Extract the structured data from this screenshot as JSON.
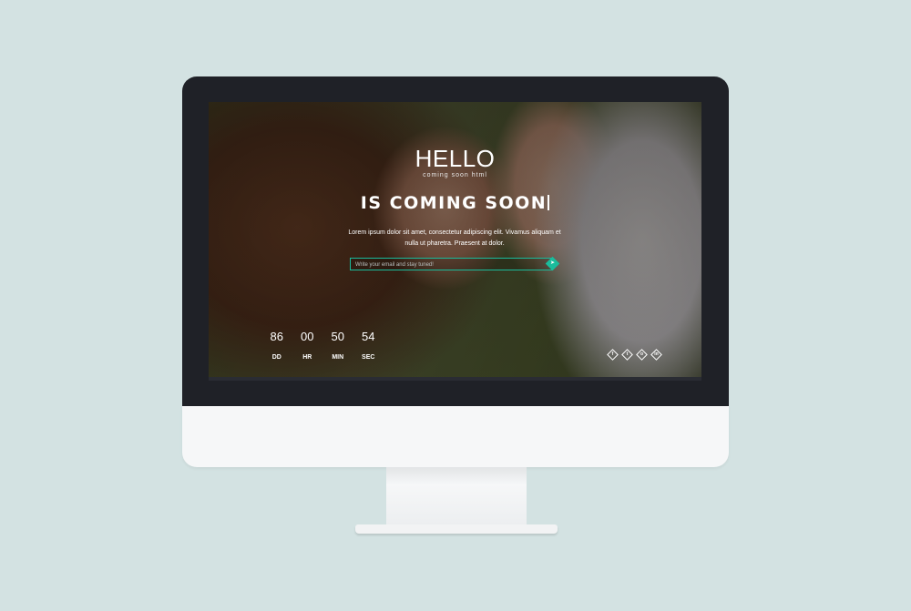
{
  "hero": {
    "title": "HELLO",
    "subtitle": "coming soon html",
    "headline": "IS COMING SOON"
  },
  "intro_text": "Lorem ipsum dolor sit amet, consectetur adipiscing elit. Vivamus aliquam et nulla ut pharetra. Praesent at dolor.",
  "subscribe": {
    "placeholder": "Write your email and stay tuned!",
    "button_icon": "arrow-icon"
  },
  "countdown": [
    {
      "value": "86",
      "label": "DD"
    },
    {
      "value": "00",
      "label": "HR"
    },
    {
      "value": "50",
      "label": "MIN"
    },
    {
      "value": "54",
      "label": "SEC"
    }
  ],
  "social": [
    {
      "icon": "facebook-icon",
      "glyph": "f"
    },
    {
      "icon": "twitter-icon",
      "glyph": "t"
    },
    {
      "icon": "instagram-icon",
      "glyph": "o"
    },
    {
      "icon": "linkedin-icon",
      "glyph": "in"
    }
  ],
  "colors": {
    "accent": "#1abc9c",
    "background": "#d3e2e2",
    "bezel": "#1f2127"
  }
}
